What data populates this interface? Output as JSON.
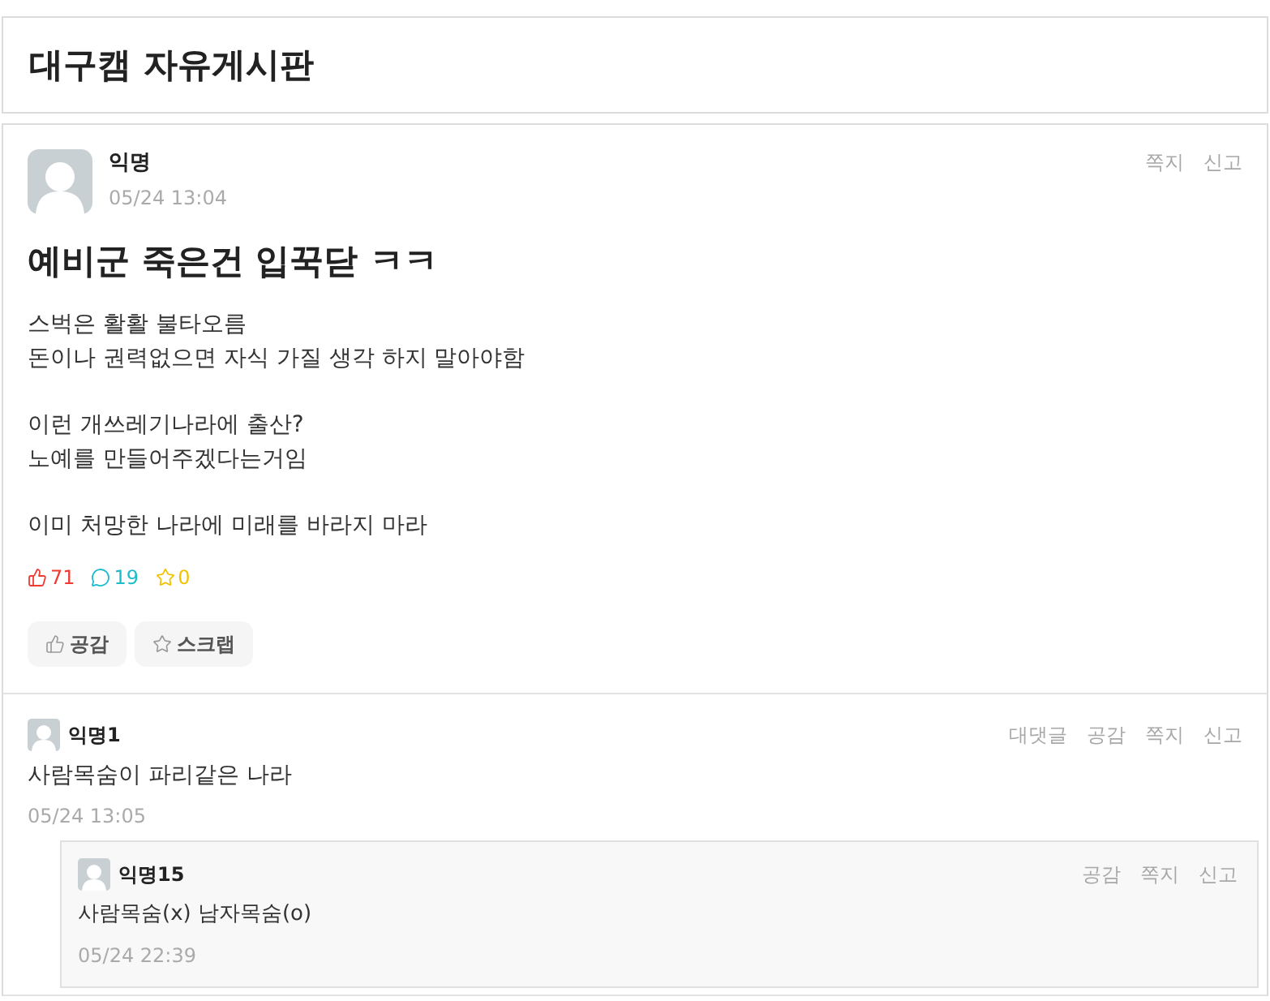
{
  "board": {
    "title": "대구캠 자유게시판"
  },
  "post": {
    "author": "익명",
    "time": "05/24 13:04",
    "actions": [
      "쪽지",
      "신고"
    ],
    "title": "예비군 죽은건 입꾹닫 ㅋㅋ",
    "paragraphs": [
      [
        "스벅은 활활 불타오름",
        "돈이나 권력없으면 자식 가질 생각 하지 말아야함"
      ],
      [
        "이런 개쓰레기나라에 출산?",
        "노예를 만들어주겠다는거임"
      ],
      [
        "이미 처망한 나라에 미래를 바라지 마라"
      ]
    ],
    "stats": [
      {
        "kind": "likes",
        "count": "71",
        "color": "#f03b32"
      },
      {
        "kind": "comments",
        "count": "19",
        "color": "#1cbccc"
      },
      {
        "kind": "scraps",
        "count": "0",
        "color": "#f2c200"
      }
    ],
    "buttons": [
      {
        "kind": "like",
        "label": "공감"
      },
      {
        "kind": "scrap",
        "label": "스크랩"
      }
    ]
  },
  "comments": [
    {
      "author": "익명1",
      "text": "사람목숨이 파리같은 나라",
      "time": "05/24 13:05",
      "actions": [
        "대댓글",
        "공감",
        "쪽지",
        "신고"
      ],
      "children": [
        {
          "author": "익명15",
          "text": "사람목숨(x) 남자목숨(o)",
          "time": "05/24 22:39",
          "actions": [
            "공감",
            "쪽지",
            "신고"
          ]
        }
      ]
    }
  ]
}
